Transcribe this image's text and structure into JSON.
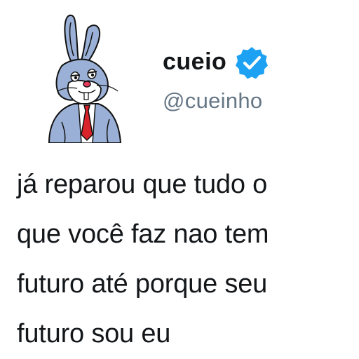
{
  "user": {
    "display_name": "cueio",
    "handle": "@cueinho",
    "verified": true,
    "avatar_icon": "bugs-bunny-avatar",
    "verified_color": "#1da1f2"
  },
  "tweet": {
    "lines": [
      "já reparou que tudo o",
      "que você faz nao tem",
      "futuro até porque seu",
      "futuro sou eu"
    ]
  },
  "colors": {
    "text": "#14171a",
    "handle": "#657786",
    "background": "#ffffff"
  }
}
